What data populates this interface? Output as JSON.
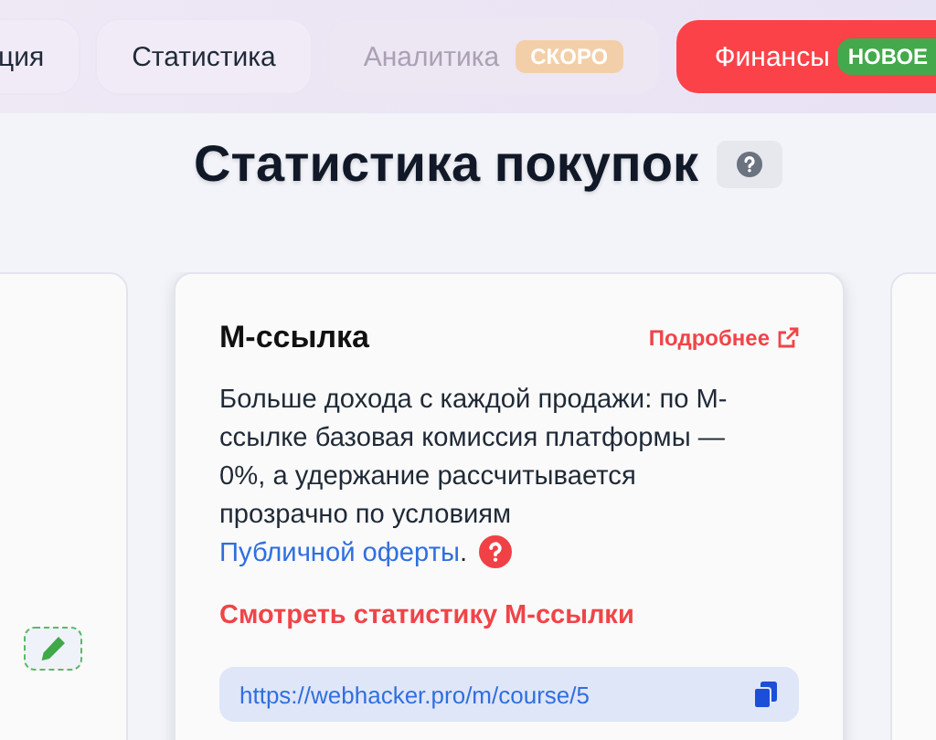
{
  "tabs": [
    {
      "label": "ция",
      "disabled": false,
      "accent": false
    },
    {
      "label": "Статистика",
      "disabled": false,
      "accent": false
    },
    {
      "label": "Аналитика",
      "disabled": true,
      "accent": false,
      "badge": "СКОРО"
    },
    {
      "label": "Финансы",
      "disabled": false,
      "accent": true,
      "badge": "НОВОЕ"
    }
  ],
  "page_title": "Статистика покупок",
  "card": {
    "title": "М-ссылка",
    "more_link": "Подробнее",
    "description": "Больше дохода с каждой продажи: по М-ссылке базовая комиссия платформы — 0%, а удержание рассчитывается прозрачно по условиям ",
    "offer_link": "Публичной оферты",
    "description_end": ".",
    "stats_link": "Смотреть статистику М-ссылки",
    "url": "https://webhacker.pro/m/course/5"
  }
}
